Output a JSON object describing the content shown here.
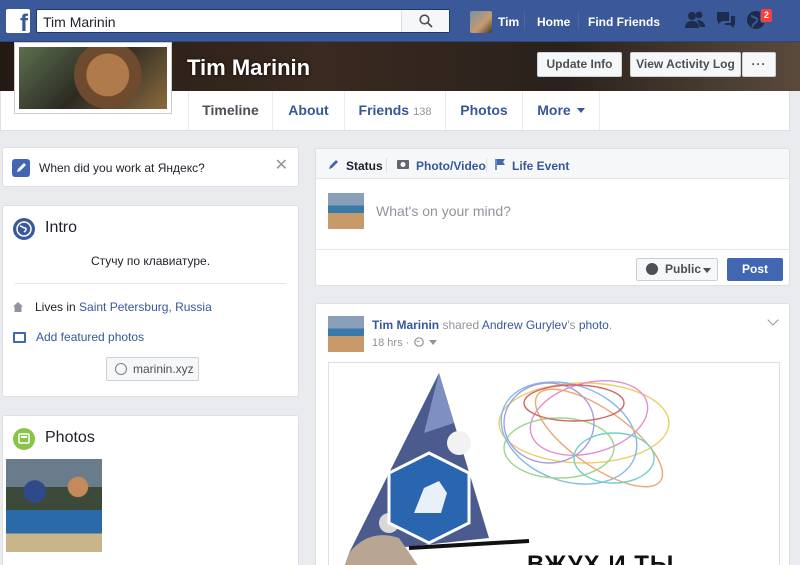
{
  "header": {
    "search_value": "Tim Marinin",
    "user_name": "Tim",
    "home": "Home",
    "find_friends": "Find Friends",
    "notifications_count": "2"
  },
  "profile": {
    "name": "Tim Marinin",
    "update_info": "Update Info",
    "view_activity_log": "View Activity Log",
    "more_dots": "···"
  },
  "tabs": {
    "timeline": "Timeline",
    "about": "About",
    "friends": "Friends",
    "friends_count": "138",
    "photos": "Photos",
    "more": "More"
  },
  "work_prompt": "When did you work at Яндекс?",
  "intro": {
    "title": "Intro",
    "bio": "Стучу по клавиатуре.",
    "lives_prefix": "Lives in ",
    "lives_city": "Saint Petersburg, Russia",
    "add_featured": "Add featured photos",
    "website": "marinin.xyz"
  },
  "photos_card": {
    "title": "Photos"
  },
  "composer": {
    "status": "Status",
    "photo_video": "Photo/Video",
    "life_event": "Life Event",
    "placeholder": "What's on your mind?",
    "privacy": "Public",
    "post": "Post"
  },
  "post": {
    "author": "Tim Marinin",
    "action": " shared ",
    "source": "Andrew Gurylev",
    "possessive": "'s ",
    "object": "photo",
    "period": ".",
    "time": "18 hrs ·",
    "caption_text": "ВЖУХ И ТЫ"
  },
  "colors": {
    "brand": "#3b5998",
    "link": "#365899",
    "button": "#4267b2",
    "badge": "#fa3e3e"
  }
}
